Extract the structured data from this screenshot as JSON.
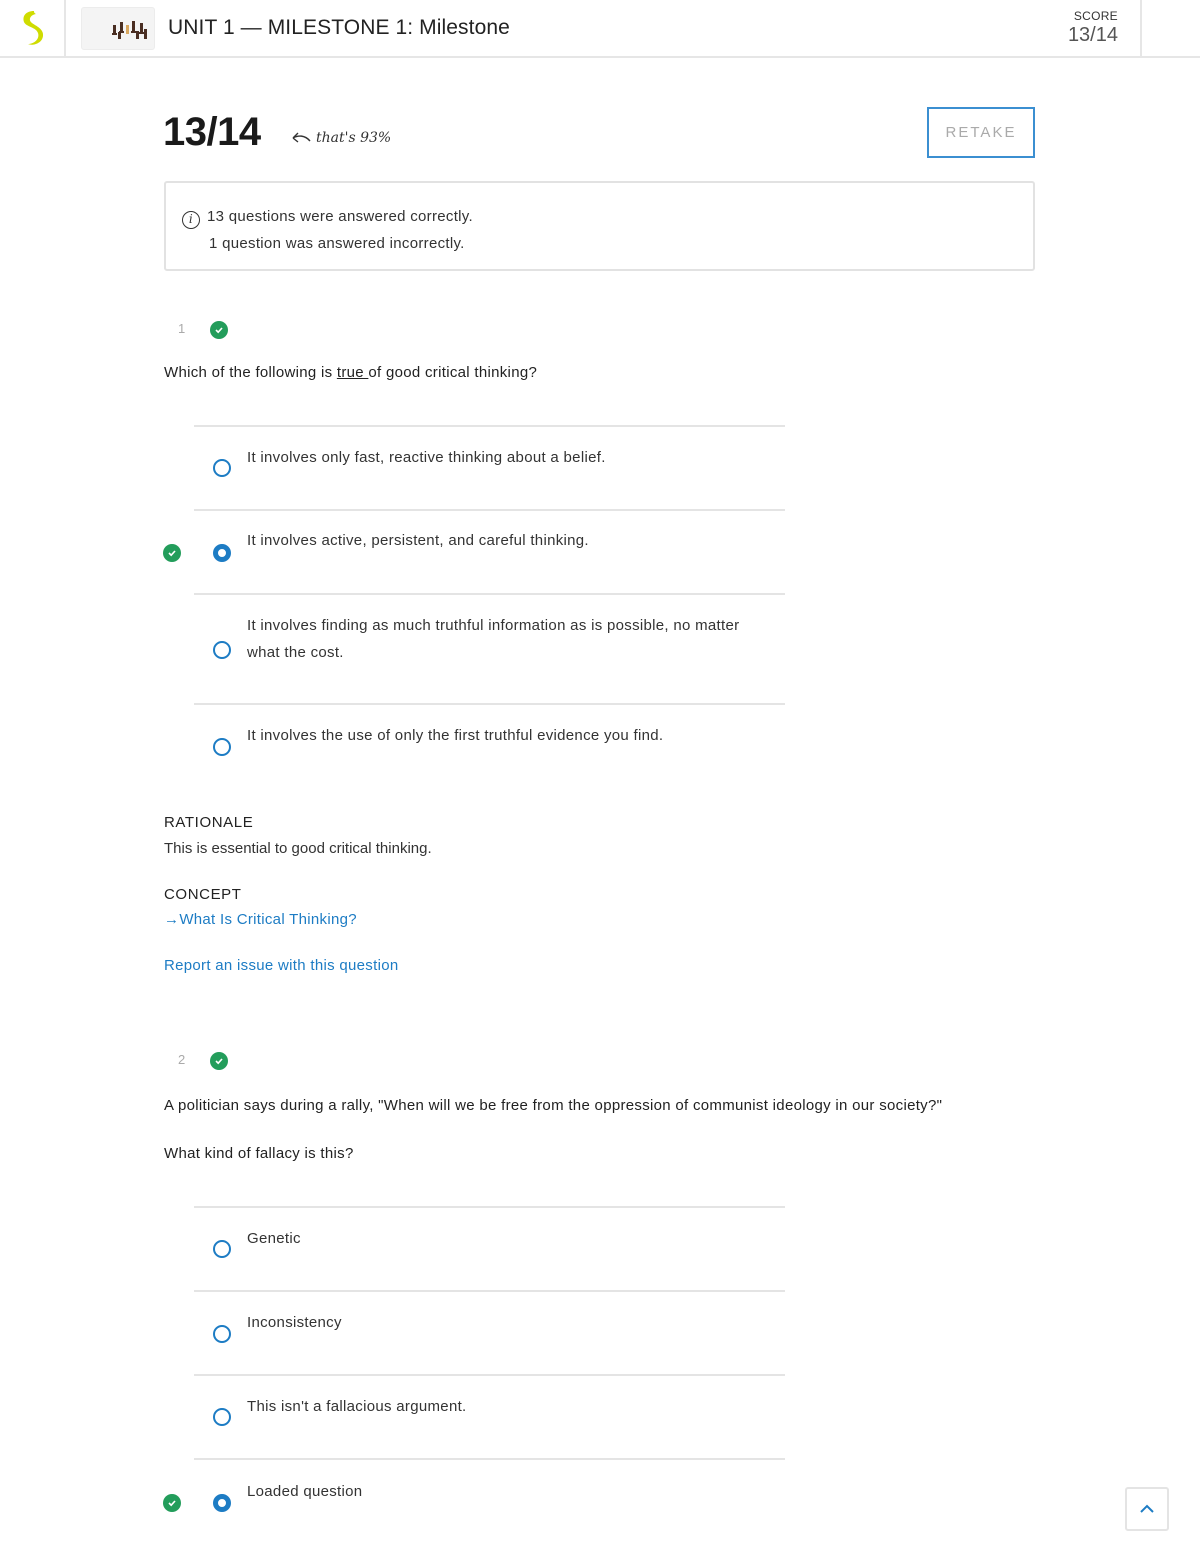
{
  "header": {
    "logo_icon": "sophia-logo-icon",
    "thumbnail_icon": "chess-pieces-thumbnail",
    "title": "UNIT 1 — MILESTONE 1: Milestone",
    "score_label": "SCORE",
    "score_value": "13/14"
  },
  "summary": {
    "score": "13/14",
    "percent_note": "that's 93%",
    "retake_label": "RETAKE",
    "info_icon": "info-icon",
    "correct_text": "13 questions were answered correctly.",
    "incorrect_text": "1 question was answered incorrectly."
  },
  "colors": {
    "accent_blue": "#1d7cc4",
    "correct_green": "#239d5b",
    "logo_yellow": "#cfdc00"
  },
  "questions": [
    {
      "number": "1",
      "status": "correct",
      "prompt_before": "Which of the following is ",
      "prompt_emphasis": "true ",
      "prompt_after": "of good critical thinking?",
      "options": [
        {
          "text": "It involves only fast, reactive thinking about a belief.",
          "selected": false,
          "correct": false
        },
        {
          "text": "It involves active, persistent, and careful thinking.",
          "selected": true,
          "correct": true
        },
        {
          "text": "It involves finding as much truthful information as is possible, no matter what the cost.",
          "selected": false,
          "correct": false
        },
        {
          "text": "It involves the use of only the first truthful evidence you find.",
          "selected": false,
          "correct": false
        }
      ],
      "rationale_label": "RATIONALE",
      "rationale_text": "This is essential to good critical thinking.",
      "concept_label": "CONCEPT",
      "concept_link": "What Is Critical Thinking?",
      "report_link": "Report an issue with this question"
    },
    {
      "number": "2",
      "status": "correct",
      "prompt": "A politician says during a rally, \"When will we be free from the oppression of communist ideology in our society?\"",
      "prompt_sub": "What kind of fallacy is this?",
      "options": [
        {
          "text": "Genetic",
          "selected": false,
          "correct": false
        },
        {
          "text": "Inconsistency",
          "selected": false,
          "correct": false
        },
        {
          "text": "This isn't a fallacious argument.",
          "selected": false,
          "correct": false
        },
        {
          "text": "Loaded question",
          "selected": true,
          "correct": true
        }
      ]
    }
  ],
  "scroll_top_icon": "chevron-up-icon"
}
